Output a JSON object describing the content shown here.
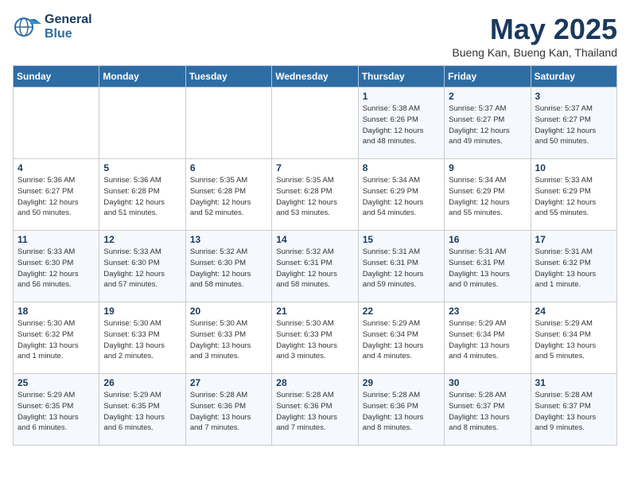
{
  "header": {
    "logo_line1": "General",
    "logo_line2": "Blue",
    "month": "May 2025",
    "location": "Bueng Kan, Bueng Kan, Thailand"
  },
  "weekdays": [
    "Sunday",
    "Monday",
    "Tuesday",
    "Wednesday",
    "Thursday",
    "Friday",
    "Saturday"
  ],
  "weeks": [
    [
      {
        "day": "",
        "info": ""
      },
      {
        "day": "",
        "info": ""
      },
      {
        "day": "",
        "info": ""
      },
      {
        "day": "",
        "info": ""
      },
      {
        "day": "1",
        "info": "Sunrise: 5:38 AM\nSunset: 6:26 PM\nDaylight: 12 hours\nand 48 minutes."
      },
      {
        "day": "2",
        "info": "Sunrise: 5:37 AM\nSunset: 6:27 PM\nDaylight: 12 hours\nand 49 minutes."
      },
      {
        "day": "3",
        "info": "Sunrise: 5:37 AM\nSunset: 6:27 PM\nDaylight: 12 hours\nand 50 minutes."
      }
    ],
    [
      {
        "day": "4",
        "info": "Sunrise: 5:36 AM\nSunset: 6:27 PM\nDaylight: 12 hours\nand 50 minutes."
      },
      {
        "day": "5",
        "info": "Sunrise: 5:36 AM\nSunset: 6:28 PM\nDaylight: 12 hours\nand 51 minutes."
      },
      {
        "day": "6",
        "info": "Sunrise: 5:35 AM\nSunset: 6:28 PM\nDaylight: 12 hours\nand 52 minutes."
      },
      {
        "day": "7",
        "info": "Sunrise: 5:35 AM\nSunset: 6:28 PM\nDaylight: 12 hours\nand 53 minutes."
      },
      {
        "day": "8",
        "info": "Sunrise: 5:34 AM\nSunset: 6:29 PM\nDaylight: 12 hours\nand 54 minutes."
      },
      {
        "day": "9",
        "info": "Sunrise: 5:34 AM\nSunset: 6:29 PM\nDaylight: 12 hours\nand 55 minutes."
      },
      {
        "day": "10",
        "info": "Sunrise: 5:33 AM\nSunset: 6:29 PM\nDaylight: 12 hours\nand 55 minutes."
      }
    ],
    [
      {
        "day": "11",
        "info": "Sunrise: 5:33 AM\nSunset: 6:30 PM\nDaylight: 12 hours\nand 56 minutes."
      },
      {
        "day": "12",
        "info": "Sunrise: 5:33 AM\nSunset: 6:30 PM\nDaylight: 12 hours\nand 57 minutes."
      },
      {
        "day": "13",
        "info": "Sunrise: 5:32 AM\nSunset: 6:30 PM\nDaylight: 12 hours\nand 58 minutes."
      },
      {
        "day": "14",
        "info": "Sunrise: 5:32 AM\nSunset: 6:31 PM\nDaylight: 12 hours\nand 58 minutes."
      },
      {
        "day": "15",
        "info": "Sunrise: 5:31 AM\nSunset: 6:31 PM\nDaylight: 12 hours\nand 59 minutes."
      },
      {
        "day": "16",
        "info": "Sunrise: 5:31 AM\nSunset: 6:31 PM\nDaylight: 13 hours\nand 0 minutes."
      },
      {
        "day": "17",
        "info": "Sunrise: 5:31 AM\nSunset: 6:32 PM\nDaylight: 13 hours\nand 1 minute."
      }
    ],
    [
      {
        "day": "18",
        "info": "Sunrise: 5:30 AM\nSunset: 6:32 PM\nDaylight: 13 hours\nand 1 minute."
      },
      {
        "day": "19",
        "info": "Sunrise: 5:30 AM\nSunset: 6:33 PM\nDaylight: 13 hours\nand 2 minutes."
      },
      {
        "day": "20",
        "info": "Sunrise: 5:30 AM\nSunset: 6:33 PM\nDaylight: 13 hours\nand 3 minutes."
      },
      {
        "day": "21",
        "info": "Sunrise: 5:30 AM\nSunset: 6:33 PM\nDaylight: 13 hours\nand 3 minutes."
      },
      {
        "day": "22",
        "info": "Sunrise: 5:29 AM\nSunset: 6:34 PM\nDaylight: 13 hours\nand 4 minutes."
      },
      {
        "day": "23",
        "info": "Sunrise: 5:29 AM\nSunset: 6:34 PM\nDaylight: 13 hours\nand 4 minutes."
      },
      {
        "day": "24",
        "info": "Sunrise: 5:29 AM\nSunset: 6:34 PM\nDaylight: 13 hours\nand 5 minutes."
      }
    ],
    [
      {
        "day": "25",
        "info": "Sunrise: 5:29 AM\nSunset: 6:35 PM\nDaylight: 13 hours\nand 6 minutes."
      },
      {
        "day": "26",
        "info": "Sunrise: 5:29 AM\nSunset: 6:35 PM\nDaylight: 13 hours\nand 6 minutes."
      },
      {
        "day": "27",
        "info": "Sunrise: 5:28 AM\nSunset: 6:36 PM\nDaylight: 13 hours\nand 7 minutes."
      },
      {
        "day": "28",
        "info": "Sunrise: 5:28 AM\nSunset: 6:36 PM\nDaylight: 13 hours\nand 7 minutes."
      },
      {
        "day": "29",
        "info": "Sunrise: 5:28 AM\nSunset: 6:36 PM\nDaylight: 13 hours\nand 8 minutes."
      },
      {
        "day": "30",
        "info": "Sunrise: 5:28 AM\nSunset: 6:37 PM\nDaylight: 13 hours\nand 8 minutes."
      },
      {
        "day": "31",
        "info": "Sunrise: 5:28 AM\nSunset: 6:37 PM\nDaylight: 13 hours\nand 9 minutes."
      }
    ]
  ]
}
